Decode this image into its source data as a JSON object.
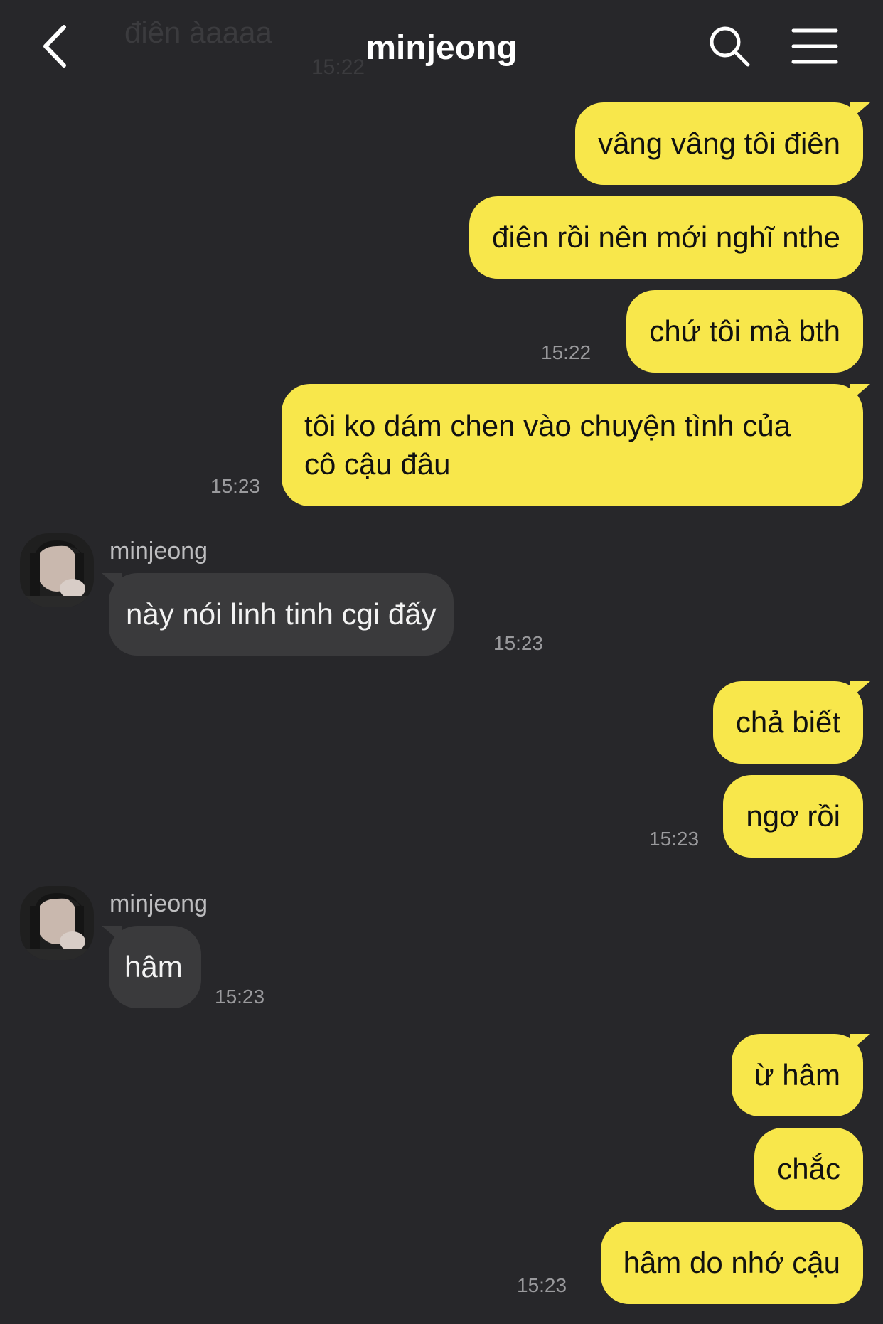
{
  "header": {
    "title": "minjeong",
    "ghost_message": "điên àaaaa",
    "ghost_time": "15:22"
  },
  "messages": [
    {
      "text": "vâng vâng tôi điên"
    },
    {
      "text": "điên rồi nên mới nghĩ nthe"
    },
    {
      "text": "chứ tôi mà bth",
      "time": "15:22"
    },
    {
      "line1": "tôi ko dám chen vào chuyện tình của",
      "line2": "cô cậu đâu",
      "time": "15:23"
    },
    {
      "sender": "minjeong",
      "text": "này nói linh tinh cgi đấy",
      "time": "15:23"
    },
    {
      "text": "chả biết"
    },
    {
      "text": "ngơ rồi",
      "time": "15:23"
    },
    {
      "sender": "minjeong",
      "text": "hâm",
      "time": "15:23"
    },
    {
      "text": "ừ hâm"
    },
    {
      "text": "chắc"
    },
    {
      "text": "hâm do nhớ cậu",
      "time": "15:23"
    }
  ],
  "colors": {
    "background": "#27272a",
    "outgoing_bubble": "#f8e74b",
    "incoming_bubble": "#3a3a3c",
    "timestamp": "#9a9a9d"
  },
  "icons": [
    "back-chevron-icon",
    "search-icon",
    "menu-icon"
  ]
}
